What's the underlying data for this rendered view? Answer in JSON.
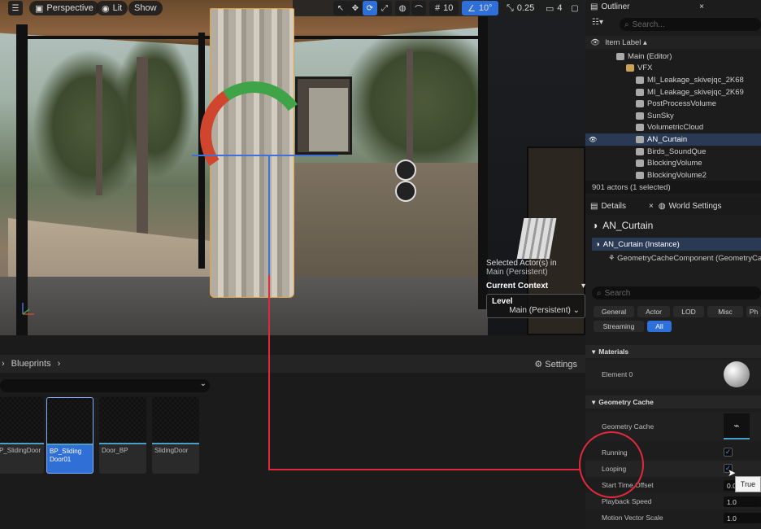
{
  "viewport": {
    "menu_icon": "hamburger-icon",
    "perspective_label": "Perspective",
    "lit_label": "Lit",
    "show_label": "Show",
    "grid_snap_value": "10",
    "rotation_snap_value": "10°",
    "scale_snap_value": "0.25",
    "camera_speed_value": "4",
    "context": {
      "selected_line1": "Selected Actor(s) in",
      "selected_line2": "Main (Persistent)",
      "current_context_label": "Current Context",
      "level_label": "Level",
      "level_value": "Main (Persistent)"
    }
  },
  "content_browser": {
    "breadcrumb": "Blueprints",
    "settings_label": "Settings",
    "assets": [
      {
        "label": "P_SlidingDoor",
        "selected": false
      },
      {
        "label": "BP_Sliding Door01",
        "selected": true
      },
      {
        "label": "Door_BP",
        "selected": false
      },
      {
        "label": "SlidingDoor",
        "selected": false
      }
    ]
  },
  "outliner": {
    "tab_label": "Outliner",
    "search_placeholder": "Search...",
    "column_label": "Item Label ▴",
    "items": [
      {
        "label": "Main (Editor)",
        "icon": "level-icon",
        "indent": 1,
        "selected": false
      },
      {
        "label": "VFX",
        "icon": "folder-icon",
        "indent": 2,
        "selected": false
      },
      {
        "label": "MI_Leakage_skivejqc_2K68",
        "icon": "mesh-icon",
        "indent": 3,
        "selected": false
      },
      {
        "label": "MI_Leakage_skivejqc_2K69",
        "icon": "mesh-icon",
        "indent": 3,
        "selected": false
      },
      {
        "label": "PostProcessVolume",
        "icon": "volume-icon",
        "indent": 3,
        "selected": false
      },
      {
        "label": "SunSky",
        "icon": "sun-icon",
        "indent": 3,
        "selected": false
      },
      {
        "label": "VolumetricCloud",
        "icon": "cloud-icon",
        "indent": 3,
        "selected": false
      },
      {
        "label": "AN_Curtain",
        "icon": "actor-icon",
        "indent": 3,
        "selected": true
      },
      {
        "label": "Birds_SoundQue",
        "icon": "sound-icon",
        "indent": 3,
        "selected": false
      },
      {
        "label": "BlockingVolume",
        "icon": "volume-icon",
        "indent": 3,
        "selected": false
      },
      {
        "label": "BlockingVolume2",
        "icon": "volume-icon",
        "indent": 3,
        "selected": false
      }
    ],
    "status": "901 actors (1 selected)"
  },
  "details": {
    "tab_label": "Details",
    "world_settings_label": "World Settings",
    "actor_name": "AN_Curtain",
    "instance_label": "AN_Curtain (Instance)",
    "component_label": "GeometryCacheComponent (GeometryCa",
    "search_placeholder": "Search",
    "filters": [
      "General",
      "Actor",
      "LOD",
      "Misc",
      "Ph",
      "Streaming",
      "All"
    ],
    "materials_section": "Materials",
    "element0_label": "Element 0",
    "geometry_cache_section": "Geometry Cache",
    "geometry_cache_label": "Geometry Cache",
    "running_label": "Running",
    "looping_label": "Looping",
    "start_time_offset_label": "Start Time Offset",
    "start_time_offset_value": "0.0",
    "playback_speed_label": "Playback Speed",
    "playback_speed_value": "1.0",
    "motion_vector_scale_label": "Motion Vector Scale",
    "motion_vector_scale_value": "1.0",
    "running_checked": true,
    "looping_checked": true,
    "tooltip": "True"
  },
  "colors": {
    "selection_blue": "#2e6fd9",
    "annotation_red": "#e2283d",
    "outline_orange": "#e2a23c"
  }
}
